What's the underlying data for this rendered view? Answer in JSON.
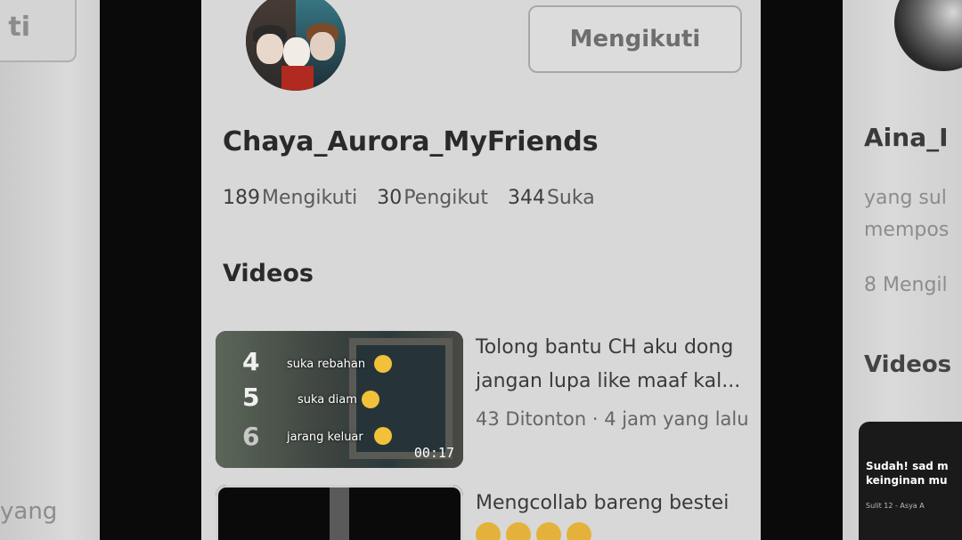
{
  "left_card": {
    "button_fragment": "ti",
    "text_fragment": "yang"
  },
  "profile": {
    "follow_button": "Mengikuti",
    "username": "Chaya_Aurora_MyFriends",
    "stats": [
      {
        "value": "189",
        "label": "Mengikuti"
      },
      {
        "value": "30",
        "label": "Pengikut"
      },
      {
        "value": "344",
        "label": "Suka"
      }
    ],
    "videos_heading": "Videos"
  },
  "videos": [
    {
      "title": "Tolong bantu CH aku dong jangan lupa like maaf kal...",
      "views": "43 Ditonton",
      "separator": " · ",
      "ago": "4 jam yang lalu",
      "duration": "00:17",
      "thumb_numbers": [
        "4",
        "5",
        "6"
      ],
      "thumb_captions": [
        "suka rebahan",
        "suka diam",
        "jarang keluar"
      ]
    },
    {
      "title": "Mengcollab bareng bestei"
    }
  ],
  "right_card": {
    "name": "Aina_I",
    "bio_line1": "yang sul",
    "bio_line2": "mempos",
    "stat": "8 Mengil",
    "videos_heading": "Videos",
    "thumb_text": "Sudah! sad m\nkeinginan mu",
    "thumb_small": "Sulit 12 - Asya A"
  },
  "colors": {
    "card_bg": "#d8d8d8",
    "outer_bg": "#0a0a0a",
    "text_dark": "#2a2a2a",
    "text_muted": "#5a5a5a"
  }
}
